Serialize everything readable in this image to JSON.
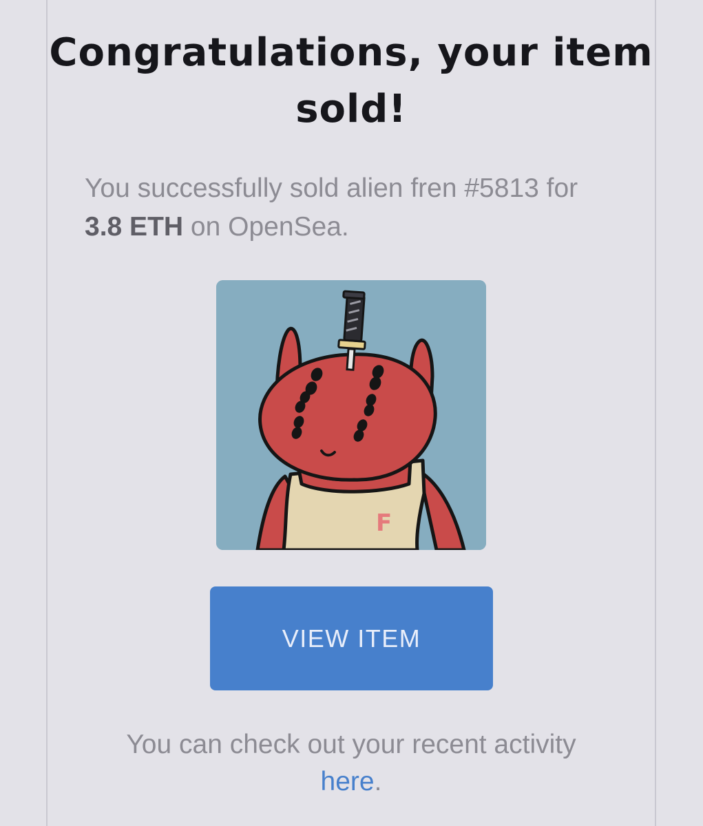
{
  "email": {
    "headline": "Congratulations, your item sold!",
    "message": {
      "prefix": "You successfully sold alien fren #5813 for ",
      "price": "3.8 ETH",
      "suffix": " on OpenSea."
    },
    "nft_image": {
      "name": "alien fren #5813",
      "shirt_letter": "F"
    },
    "button": {
      "label": "VIEW ITEM"
    },
    "footer": {
      "text": "You can check out your recent activity ",
      "link_label": "here",
      "trailing": "."
    }
  },
  "colors": {
    "background": "#e3e2e8",
    "accent": "#4780cc",
    "headline": "#16161b",
    "body_text": "#8c8b93",
    "nft_background": "#86adc0",
    "alien_red": "#c94b4a",
    "shirt": "#e4d6b1"
  }
}
